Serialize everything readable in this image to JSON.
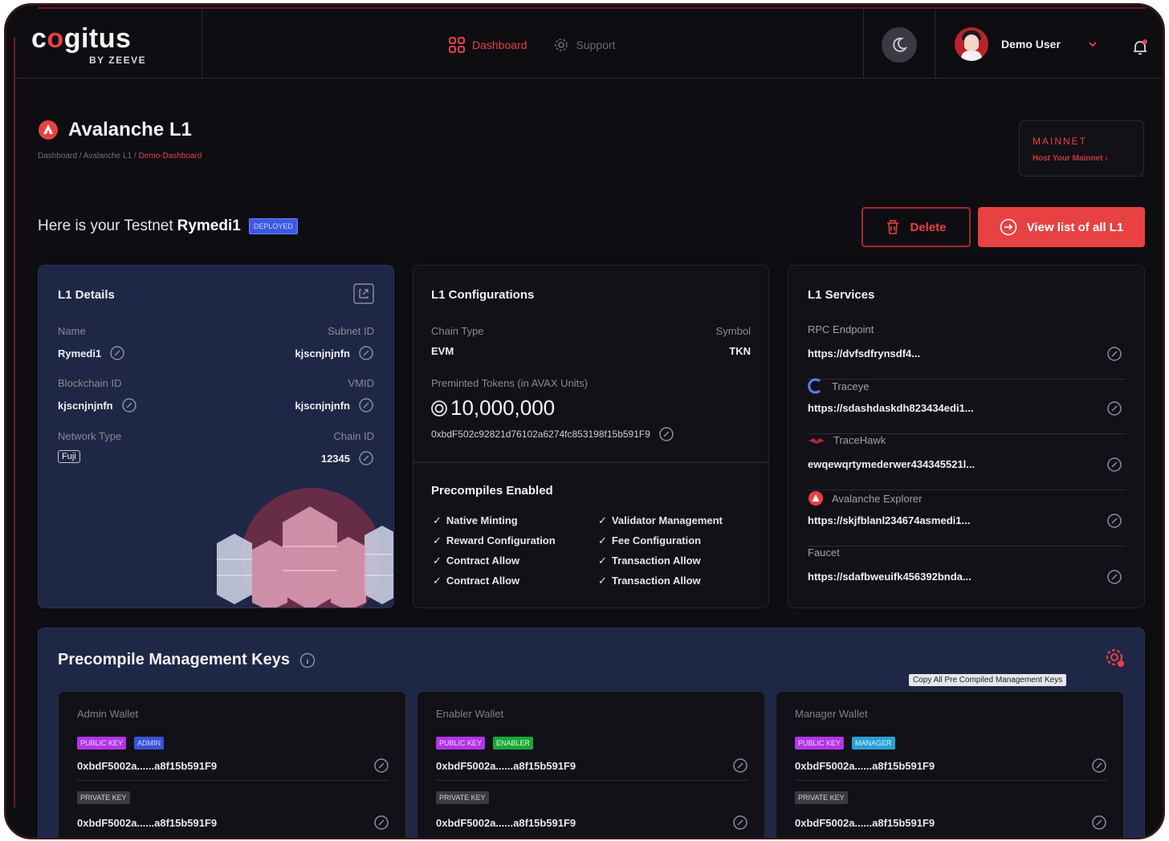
{
  "brand": {
    "name": "cogitus",
    "sub": "BY ZEEVE"
  },
  "nav": [
    {
      "label": "Dashboard",
      "icon": "grid-icon",
      "active": true
    },
    {
      "label": "Support",
      "icon": "gear-icon",
      "active": false
    }
  ],
  "user": {
    "name": "Demo User"
  },
  "page": {
    "title": "Avalanche L1",
    "breadcrumb": {
      "a": "Dashboard",
      "b": "Avalanche L1",
      "c": "Demo-Dashboard"
    },
    "network": {
      "label": "MAINNET",
      "action": "Host Your Mainnet"
    },
    "greeting_prefix": "Here is your Testnet",
    "greeting_name": "Rymedi1",
    "status": "DEPLOYED",
    "delete_label": "Delete",
    "view_label": "View list of all L1"
  },
  "details": {
    "title": "L1 Details",
    "name_label": "Name",
    "name": "Rymedi1",
    "subnet_label": "Subnet ID",
    "subnet": "kjscnjnjnfn",
    "blockchain_label": "Blockchain ID",
    "blockchain": "kjscnjnjnfn",
    "vmid_label": "VMID",
    "vmid": "kjscnjnjnfn",
    "network_label": "Network Type",
    "network": "Fuji",
    "chain_label": "Chain ID",
    "chain": "12345"
  },
  "config": {
    "title": "L1 Configurations",
    "chain_type_label": "Chain Type",
    "chain_type": "EVM",
    "symbol_label": "Symbol",
    "symbol": "TKN",
    "tokens_label": "Preminted Tokens (in AVAX Units)",
    "tokens": "10,000,000",
    "address": "0xbdF502c92821d76102a6274fc853198f15b591F9",
    "precompiles_title": "Precompiles Enabled",
    "precompiles": [
      "Native Minting",
      "Validator Management",
      "Reward Configuration",
      "Fee Configuration",
      "Contract Allow",
      "Transaction Allow",
      "Contract Allow",
      "Transaction Allow"
    ]
  },
  "services": {
    "title": "L1 Services",
    "items": [
      {
        "label": "RPC Endpoint",
        "value": "https://dvfsdfrynsdf4..."
      },
      {
        "label": "Traceye",
        "value": "https://sdashdaskdh823434edi1..."
      },
      {
        "label": "TraceHawk",
        "value": "ewqewqrtymederwer434345521l..."
      },
      {
        "label": "Avalanche Explorer",
        "value": "https://skjfblanl234674asmedi1..."
      },
      {
        "label": "Faucet",
        "value": "https://sdafbweuifk456392bnda..."
      }
    ]
  },
  "keys": {
    "title": "Precompile Management Keys",
    "tooltip": "Copy All Pre Compiled Management Keys",
    "public_tag": "PUBLIC KEY",
    "private_tag": "PRIVATE KEY",
    "wallets": [
      {
        "title": "Admin Wallet",
        "role": "ADMIN",
        "public": "0xbdF5002a......a8f15b591F9",
        "private": "0xbdF5002a......a8f15b591F9"
      },
      {
        "title": "Enabler Wallet",
        "role": "ENABLER",
        "public": "0xbdF5002a......a8f15b591F9",
        "private": "0xbdF5002a......a8f15b591F9"
      },
      {
        "title": "Manager Wallet",
        "role": "MANAGER",
        "public": "0xbdF5002a......a8f15b591F9",
        "private": "0xbdF5002a......a8f15b591F9"
      }
    ]
  },
  "colors": {
    "accent": "#e84142",
    "panel_blue": "#1e2745",
    "bg": "#0d0d12"
  }
}
